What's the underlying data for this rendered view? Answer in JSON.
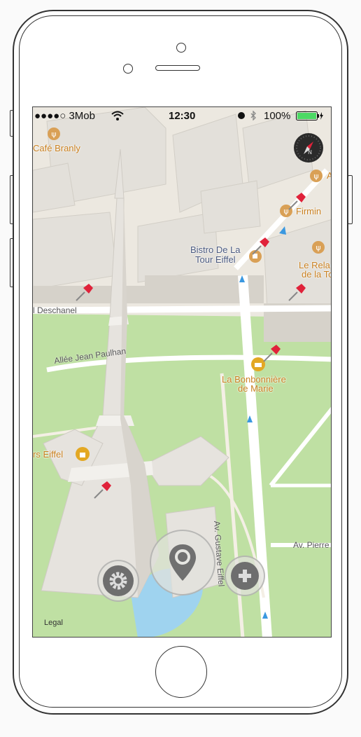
{
  "status_bar": {
    "carrier": "●●●●○ 3Mob",
    "time": "12:30",
    "battery": "100%",
    "wifi_icon": "wifi-icon",
    "alarm_icon": "alarm-icon",
    "bluetooth_icon": "bluetooth-icon"
  },
  "map": {
    "places": [
      {
        "label": "Café Branly",
        "icon": "restaurant-icon"
      },
      {
        "label": "Firmin",
        "icon": "restaurant-icon"
      },
      {
        "label": "Bistro De La",
        "label2": "Tour Eiffel",
        "icon": "cafe-icon"
      },
      {
        "label": "Le Rela",
        "label2": "de la To",
        "icon": "restaurant-icon"
      },
      {
        "label": "La Bonbonnière",
        "label2": "de Marie",
        "icon": "bakery-icon"
      },
      {
        "label": "rs Eiffel",
        "icon": "shopping-icon"
      },
      {
        "label": "A",
        "icon": "restaurant-icon"
      }
    ],
    "streets": {
      "deschanel": "l Deschanel",
      "paulhan": "Allée Jean Paulhan",
      "gustave": "Av. Gustave Eiffel",
      "pierre": "Av. Pierre"
    },
    "legal": "Legal",
    "compass_icon": "compass-icon"
  },
  "controls": {
    "settings_icon": "gear-icon",
    "location_icon": "location-pin-icon",
    "add_icon": "plus-icon"
  },
  "colors": {
    "park": "#bfe0a3",
    "building": "#e3e0da",
    "road": "#ffffff",
    "water": "#9fd3ef",
    "pin_red": "#e0223a",
    "poi_orange": "#d9a056"
  }
}
